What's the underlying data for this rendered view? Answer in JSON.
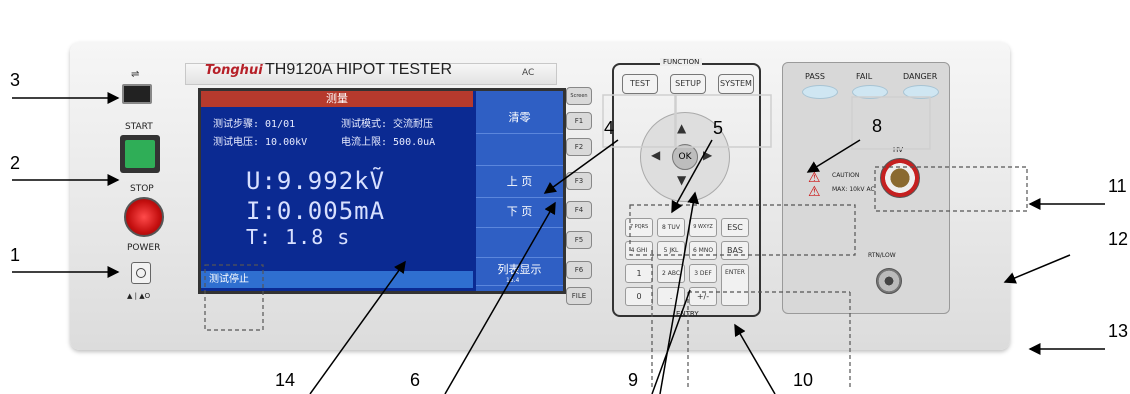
{
  "device": {
    "brand": "Tonghui",
    "model": "TH9120A  HIPOT TESTER",
    "ac_mark": "AC",
    "usb_symbol": "⭠⭢",
    "start_label": "START",
    "stop_label": "STOP",
    "power_label": "POWER",
    "power_switch_marks": "▲ | ▲O"
  },
  "screen": {
    "title": "测量",
    "step_line": "测试步骤: 01/01",
    "mode_line": "测试模式: 交流耐压",
    "voltage_set": "测试电压: 10.00kV",
    "current_limit": "电流上限: 500.0uA",
    "reading_u": "U:9.992kṼ",
    "reading_i": "I:0.005mA",
    "reading_t": "T:  1.8  s",
    "status": "测试停止",
    "softkeys": [
      "清零",
      "",
      "上 页",
      "下 页",
      "",
      "列表显示"
    ],
    "softkey_note": "15.4"
  },
  "fkeys": [
    "Screen",
    "F1",
    "F2",
    "F3",
    "F4",
    "F5",
    "F6",
    "FILE"
  ],
  "function_panel": {
    "title": "FUNCTION",
    "buttons": [
      "TEST",
      "SETUP",
      "SYSTEM"
    ],
    "ok_label": "OK",
    "entry_label": "ENTRY"
  },
  "keypad": {
    "keys": [
      "7 PQRS",
      "8 TUV",
      "9 WXYZ",
      "ESC",
      "4 GHI",
      "5 JKL",
      "6 MNO",
      "BAS",
      "1",
      "2 ABC",
      "3 DEF",
      "ENTER",
      "0",
      ".",
      "+/-",
      ""
    ]
  },
  "indicators": {
    "pass": "PASS",
    "fail": "FAIL",
    "danger": "DANGER",
    "caution_line1": "CAUTION",
    "caution_line2": "MAX: 10kV AC",
    "hv": "HV",
    "rtn": "RTN/LOW"
  },
  "callouts": [
    "1",
    "2",
    "3",
    "4",
    "5",
    "6",
    "8",
    "9",
    "10",
    "11",
    "12",
    "13",
    "14"
  ]
}
